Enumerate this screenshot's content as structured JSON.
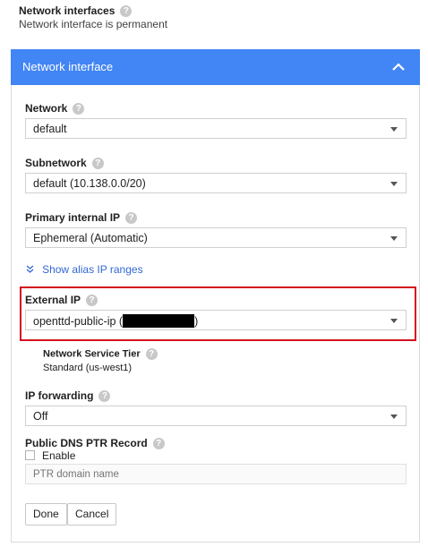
{
  "top": {
    "title": "Network interfaces",
    "subtitle": "Network interface is permanent"
  },
  "panel": {
    "title": "Network interface",
    "network": {
      "label": "Network",
      "value": "default"
    },
    "subnetwork": {
      "label": "Subnetwork",
      "value": "default (10.138.0.0/20)"
    },
    "primary_ip": {
      "label": "Primary internal IP",
      "value": "Ephemeral (Automatic)"
    },
    "alias_link": "Show alias IP ranges",
    "external_ip": {
      "label": "External IP",
      "value_prefix": "openttd-public-ip (",
      "value_suffix": ")"
    },
    "network_tier": {
      "label": "Network Service Tier",
      "value": "Standard (us-west1)"
    },
    "ip_forwarding": {
      "label": "IP forwarding",
      "value": "Off"
    },
    "dns_ptr": {
      "label": "Public DNS PTR Record",
      "enable_label": "Enable",
      "placeholder": "PTR domain name"
    },
    "buttons": {
      "done": "Done",
      "cancel": "Cancel"
    }
  },
  "colors": {
    "header_blue": "#4285f4",
    "highlight_red": "#d4111f",
    "link_blue": "#3367d6"
  }
}
